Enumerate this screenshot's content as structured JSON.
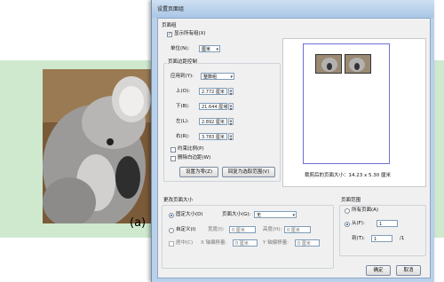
{
  "background": {
    "caption": "(a)",
    "accent": "#cfe9cf"
  },
  "dialog": {
    "title": "设置页面组",
    "page_group": {
      "heading": "页面组",
      "show_all_groups": "显示所有组(X)",
      "unit_label": "单位(N):",
      "unit_value": "厘米"
    },
    "margins": {
      "heading": "页面边距控制",
      "apply_to_label": "应用到(Y):",
      "apply_to_value": "整数组",
      "top_label": "上(O):",
      "top_value": "2.772 厘米",
      "bottom_label": "下(B):",
      "bottom_value": "21.644 厘米",
      "left_label": "左(L):",
      "left_value": "2.892 厘米",
      "right_label": "右(R):",
      "right_value": "3.783 厘米",
      "constrain_label": "约束比例(P)",
      "remove_white_label": "删除白边距(W)",
      "set_zero_button": "设置为零(Z)",
      "revert_button": "回复为选取范围(V)"
    },
    "preview": {
      "size_text": "裁剪后的页面大小：14.23 x 5.30 厘米"
    },
    "page_size": {
      "heading": "更改页面大小",
      "fixed_label": "固定大小(D)",
      "page_size_label": "页面大小(G):",
      "page_size_value": "无",
      "custom_label": "自定义(I)",
      "width_label": "宽度(I):",
      "width_value": "0 厘米",
      "height_label": "高度(H):",
      "height_value": "0 厘米",
      "center_label": "居中(C)",
      "x_offset_label": "X 轴偏移量:",
      "x_offset_value": "0 厘米",
      "y_offset_label": "Y 轴偏移量:",
      "y_offset_value": "0 厘米"
    },
    "page_range": {
      "heading": "页面范围",
      "all_pages_label": "所有页面(A)",
      "from_label": "从(F):",
      "from_value": "1",
      "to_label": "到(T):",
      "to_value": "1",
      "total": "/1"
    },
    "ok_button": "确定",
    "cancel_button": "取消"
  }
}
